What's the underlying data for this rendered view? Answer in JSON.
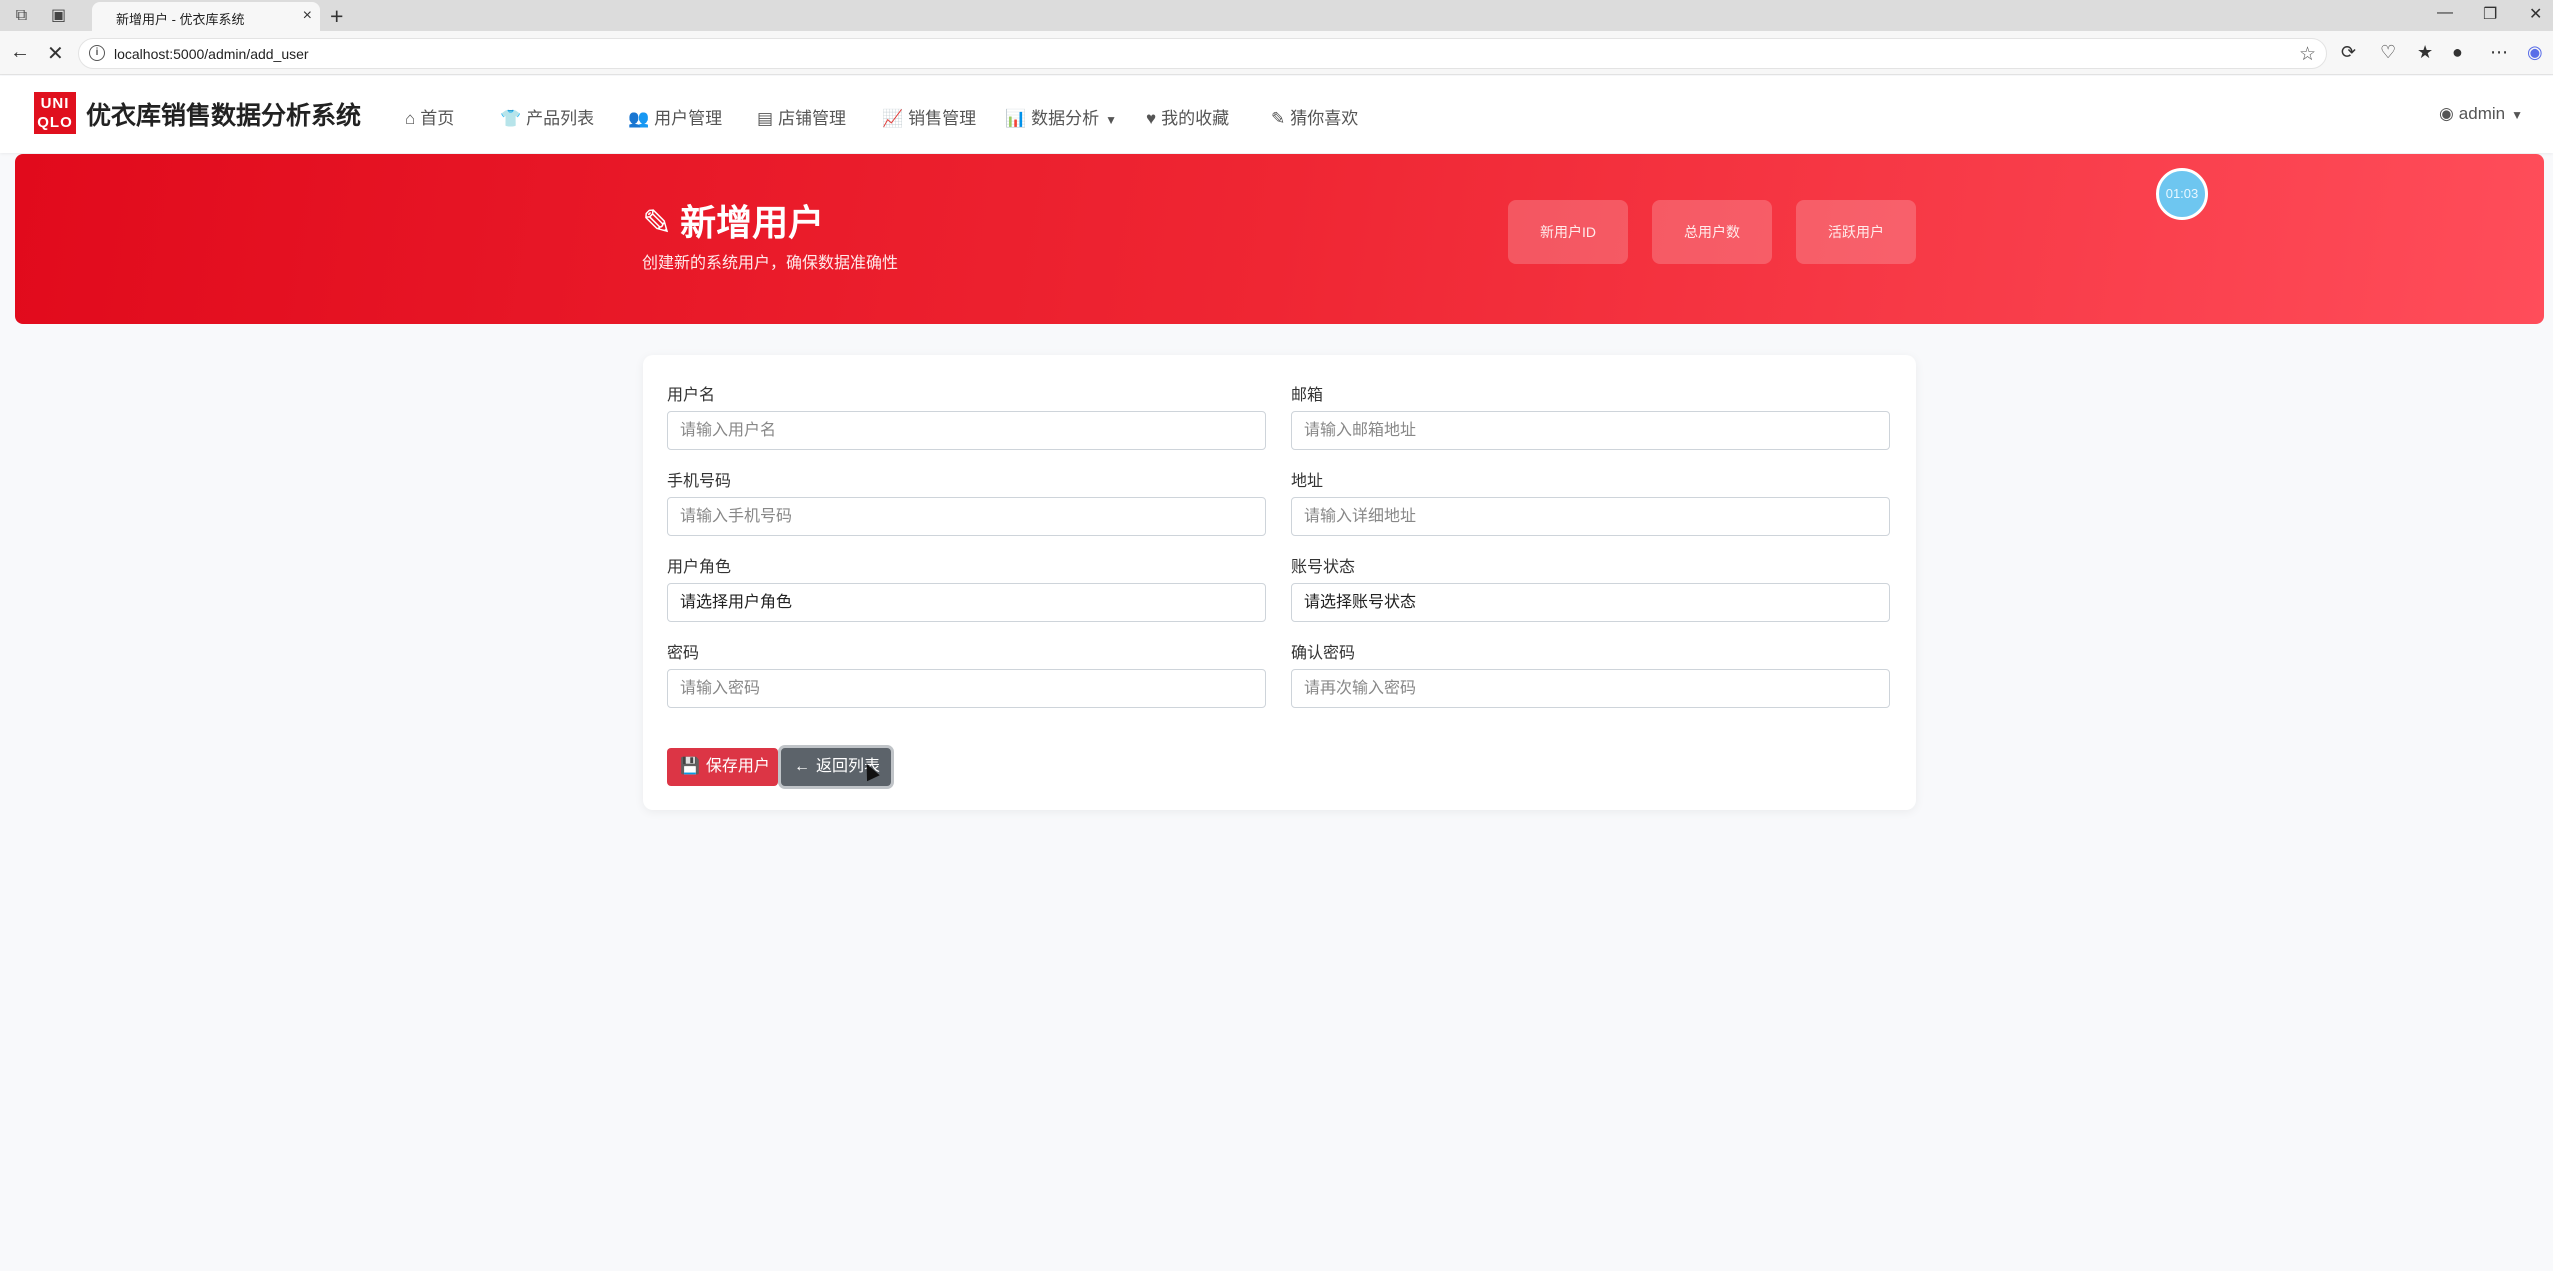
{
  "browser": {
    "tab_title": "新增用户 - 优衣库系统",
    "url": "localhost:5000/admin/add_user",
    "tab_close_icon": "×",
    "newtab_icon": "+"
  },
  "navbar": {
    "logo_text": "UNI QLO",
    "brand": "优衣库销售数据分析系统",
    "items": [
      {
        "label": "首页",
        "icon": "home-icon"
      },
      {
        "label": "产品列表",
        "icon": "shirt-icon"
      },
      {
        "label": "用户管理",
        "icon": "users-icon"
      },
      {
        "label": "店铺管理",
        "icon": "store-icon"
      },
      {
        "label": "销售管理",
        "icon": "chart-line-icon"
      },
      {
        "label": "数据分析",
        "icon": "chart-bar-icon"
      },
      {
        "label": "我的收藏",
        "icon": "heart-icon"
      },
      {
        "label": "猜你喜欢",
        "icon": "pencil-icon"
      }
    ],
    "user": "admin"
  },
  "banner": {
    "title": "新增用户",
    "subtitle": "创建新的系统用户，确保数据准确性",
    "stats": [
      "新用户ID",
      "总用户数",
      "活跃用户"
    ],
    "timer": "01:03",
    "colors": {
      "start": "#e10a1c",
      "end": "#ff4d5a"
    }
  },
  "form": {
    "username": {
      "label": "用户名",
      "placeholder": "请输入用户名"
    },
    "email": {
      "label": "邮箱",
      "placeholder": "请输入邮箱地址"
    },
    "phone": {
      "label": "手机号码",
      "placeholder": "请输入手机号码"
    },
    "address": {
      "label": "地址",
      "placeholder": "请输入详细地址"
    },
    "role": {
      "label": "用户角色",
      "value": "请选择用户角色"
    },
    "status": {
      "label": "账号状态",
      "value": "请选择账号状态"
    },
    "password": {
      "label": "密码",
      "placeholder": "请输入密码"
    },
    "confirm_password": {
      "label": "确认密码",
      "placeholder": "请再次输入密码"
    },
    "save_label": "保存用户",
    "back_label": "返回列表"
  }
}
